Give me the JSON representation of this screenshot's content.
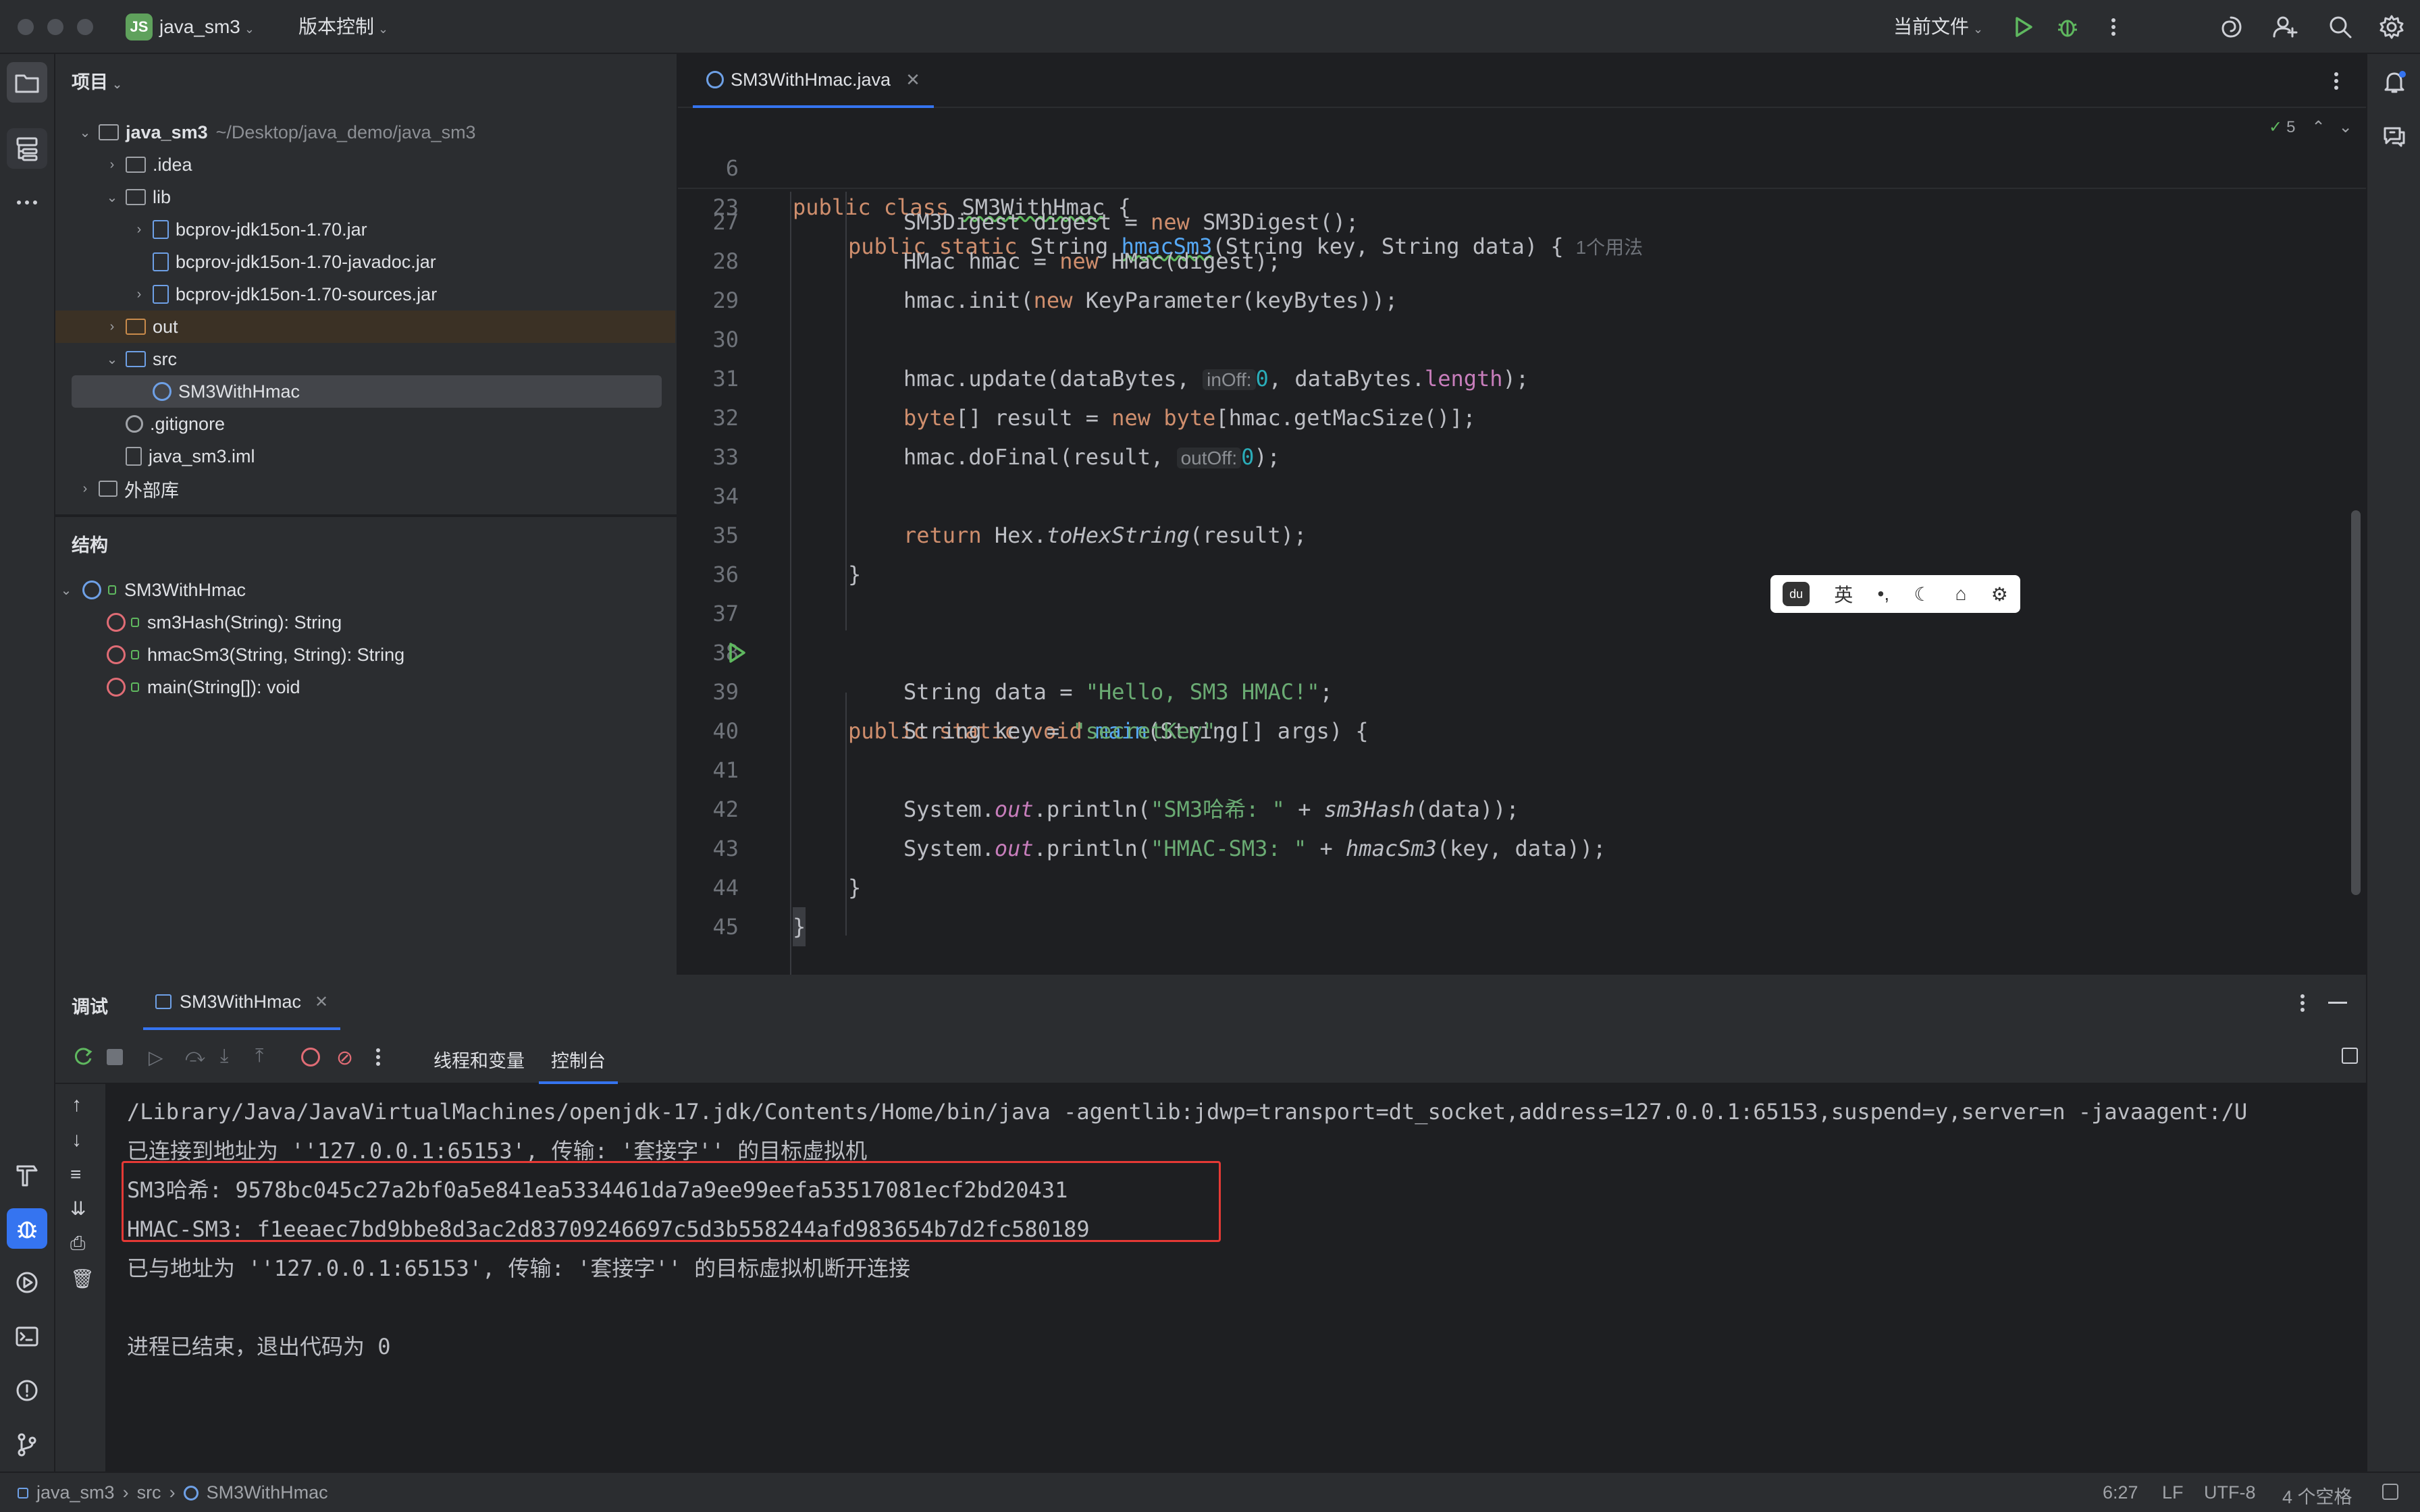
{
  "titlebar": {
    "project_badge": "JS",
    "project_name": "java_sm3",
    "vcs_label": "版本控制",
    "run_config": "当前文件"
  },
  "project_panel": {
    "title": "项目",
    "rows": [
      {
        "name": "java_sm3",
        "path": "~/Desktop/java_demo/java_sm3"
      },
      {
        "name": ".idea"
      },
      {
        "name": "lib"
      },
      {
        "name": "bcprov-jdk15on-1.70.jar"
      },
      {
        "name": "bcprov-jdk15on-1.70-javadoc.jar"
      },
      {
        "name": "bcprov-jdk15on-1.70-sources.jar"
      },
      {
        "name": "out"
      },
      {
        "name": "src"
      },
      {
        "name": "SM3WithHmac"
      },
      {
        "name": ".gitignore"
      },
      {
        "name": "java_sm3.iml"
      },
      {
        "name": "外部库"
      }
    ]
  },
  "structure_panel": {
    "title": "结构",
    "root": "SM3WithHmac",
    "members": [
      "sm3Hash(String): String",
      "hmacSm3(String, String): String",
      "main(String[]): void"
    ]
  },
  "editor": {
    "tab_label": "SM3WithHmac.java",
    "inspection_count": "5",
    "sticky": [
      {
        "ln": "6",
        "a": "public class ",
        "b": "SM3WithHmac",
        "c": " {"
      },
      {
        "ln": "23",
        "kw": "public static ",
        "t1": "String ",
        "fn": "hmacSm3",
        "t2": "(String key, String data) {",
        "usage": "1个用法"
      }
    ],
    "lines": {
      "l27": {
        "ln": "27",
        "a": "SM3Digest digest = ",
        "kw": "new",
        "b": " SM3Digest();"
      },
      "l28": {
        "ln": "28",
        "a": "HMac hmac = ",
        "kw": "new",
        "b": " HMac(digest);"
      },
      "l29": {
        "ln": "29",
        "a": "hmac.init(",
        "kw": "new",
        "b": " KeyParameter(keyBytes));"
      },
      "l30": {
        "ln": "30"
      },
      "l31": {
        "ln": "31",
        "a": "hmac.update(dataBytes, ",
        "hint": "inOff:",
        "num": "0",
        "b": ", dataBytes.",
        "field": "length",
        "c": ");"
      },
      "l32": {
        "ln": "32",
        "kw1": "byte",
        "a": "[] result = ",
        "kw2": "new",
        "sp": " ",
        "kw3": "byte",
        "b": "[hmac.getMacSize()];"
      },
      "l33": {
        "ln": "33",
        "a": "hmac.doFinal(result, ",
        "hint": "outOff:",
        "num": "0",
        "b": ");"
      },
      "l34": {
        "ln": "34"
      },
      "l35": {
        "ln": "35",
        "kw": "return",
        "a": " Hex.",
        "it": "toHexString",
        "b": "(result);"
      },
      "l36": {
        "ln": "36",
        "a": "}"
      },
      "l37": {
        "ln": "37"
      },
      "l38": {
        "ln": "38",
        "kw": "public static void ",
        "fn": "main",
        "a": "(String[] args) {"
      },
      "l39": {
        "ln": "39",
        "a": "String data = ",
        "str": "\"Hello, SM3 HMAC!\"",
        "b": ";"
      },
      "l40": {
        "ln": "40",
        "a": "String key = ",
        "str": "\"secretKey\"",
        "b": ";"
      },
      "l41": {
        "ln": "41"
      },
      "l42": {
        "ln": "42",
        "a": "System.",
        "field": "out",
        "b": ".println(",
        "str": "\"SM3哈希: \"",
        "c": " + ",
        "it": "sm3Hash",
        "d": "(data));"
      },
      "l43": {
        "ln": "43",
        "a": "System.",
        "field": "out",
        "b": ".println(",
        "str": "\"HMAC-SM3: \"",
        "c": " + ",
        "it": "hmacSm3",
        "d": "(key, data));"
      },
      "l44": {
        "ln": "44",
        "a": "}"
      },
      "l45": {
        "ln": "45",
        "a": "}"
      }
    }
  },
  "ime": {
    "lang": "英"
  },
  "debug": {
    "title": "调试",
    "session_tab": "SM3WithHmac",
    "subtab_threads": "线程和变量",
    "subtab_console": "控制台",
    "console": [
      "/Library/Java/JavaVirtualMachines/openjdk-17.jdk/Contents/Home/bin/java -agentlib:jdwp=transport=dt_socket,address=127.0.0.1:65153,suspend=y,server=n -javaagent:/U",
      "已连接到地址为 ''127.0.0.1:65153', 传输: '套接字'' 的目标虚拟机",
      "SM3哈希: 9578bc045c27a2bf0a5e841ea5334461da7a9ee99eefa53517081ecf2bd20431",
      "HMAC-SM3: f1eeaec7bd9bbe8d3ac2d83709246697c5d3b558244afd983654b7d2fc580189",
      "已与地址为 ''127.0.0.1:65153', 传输: '套接字'' 的目标虚拟机断开连接",
      "",
      "进程已结束，退出代码为 0"
    ]
  },
  "statusbar": {
    "crumbs": [
      "java_sm3",
      "src",
      "SM3WithHmac"
    ],
    "position": "6:27",
    "line_sep": "LF",
    "encoding": "UTF-8",
    "indent": "4 个空格"
  },
  "colors": {
    "accent": "#3574f0",
    "highlight_box": "#e53935",
    "keyword": "#cf8e6d",
    "string": "#6aab73",
    "function": "#56a8f5"
  }
}
